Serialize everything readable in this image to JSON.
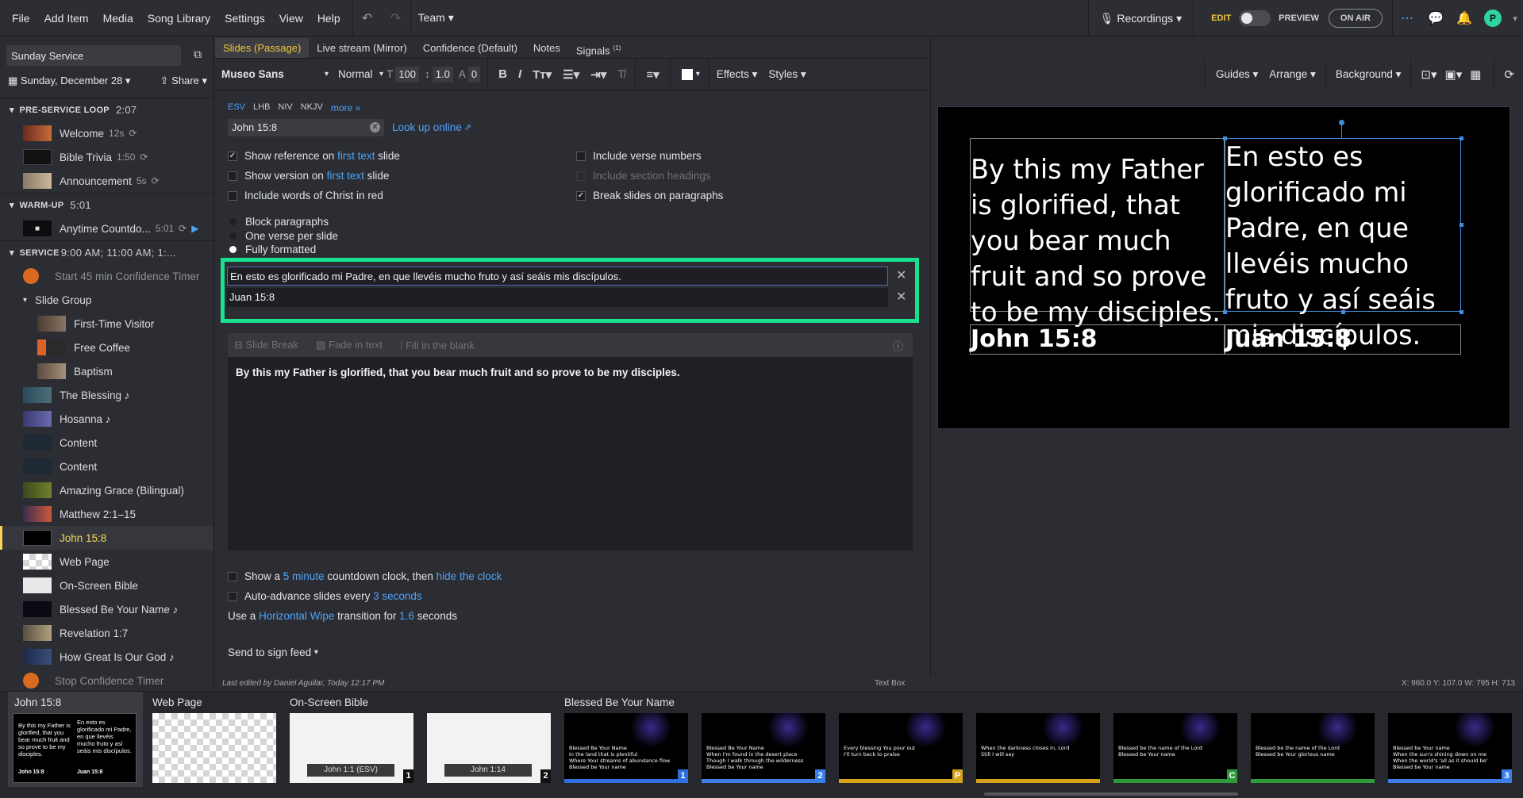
{
  "menu": [
    "File",
    "Add Item",
    "Media",
    "Song Library",
    "Settings",
    "View",
    "Help"
  ],
  "team_label": "Team",
  "topright": {
    "recordings": "Recordings",
    "edit": "EDIT",
    "preview": "PREVIEW",
    "on_air": "ON AIR"
  },
  "sidebar": {
    "service_name": "Sunday Service",
    "date": "Sunday, December 28",
    "share": "Share",
    "sections": [
      {
        "title": "PRE-SERVICE LOOP",
        "duration": "2:07"
      },
      {
        "title": "WARM-UP",
        "duration": "5:01"
      },
      {
        "title": "SERVICE",
        "duration": "9:00 AM; 11:00 AM; 1:..."
      }
    ],
    "preloop_items": [
      {
        "label": "Welcome",
        "meta": "12s"
      },
      {
        "label": "Bible Trivia",
        "meta": "1:50"
      },
      {
        "label": "Announcement",
        "meta": "5s"
      }
    ],
    "warmup_items": [
      {
        "label": "Anytime Countdo...",
        "meta": "5:01"
      }
    ],
    "service_items": [
      {
        "label": "Start 45 min Confidence Timer"
      },
      {
        "label": "Slide Group"
      },
      {
        "label": "First-Time Visitor"
      },
      {
        "label": "Free Coffee"
      },
      {
        "label": "Baptism"
      },
      {
        "label": "The Blessing ♪"
      },
      {
        "label": "Hosanna ♪"
      },
      {
        "label": "Content"
      },
      {
        "label": "Content"
      },
      {
        "label": "Amazing Grace (Bilingual)"
      },
      {
        "label": "Matthew 2:1–15"
      },
      {
        "label": "John 15:8"
      },
      {
        "label": "Web Page"
      },
      {
        "label": "On-Screen Bible"
      },
      {
        "label": "Blessed Be Your Name ♪"
      },
      {
        "label": "Revelation 1:7"
      },
      {
        "label": "How Great Is Our God ♪"
      },
      {
        "label": "Stop Confidence Timer"
      }
    ]
  },
  "tabs": [
    "Slides (Passage)",
    "Live stream (Mirror)",
    "Confidence (Default)",
    "Notes",
    "Signals"
  ],
  "signals_badge": "(1)",
  "format": {
    "font": "Museo Sans",
    "weight": "Normal",
    "size": "100",
    "line": "1.0",
    "spacing": "0",
    "effects": "Effects",
    "styles": "Styles"
  },
  "versions": [
    "ESV",
    "LHB",
    "NIV",
    "NKJV",
    "more »"
  ],
  "reference_value": "John 15:8",
  "lookup_online": "Look up online",
  "options_left": [
    {
      "pre": "Show reference on ",
      "link": "first text",
      "post": " slide",
      "checked": "✓"
    },
    {
      "pre": "Show version on ",
      "link": "first text",
      "post": " slide",
      "checked": ""
    },
    {
      "pre": "Include words of Christ in red",
      "link": "",
      "post": "",
      "checked": ""
    }
  ],
  "options_right": [
    {
      "label": "Include verse numbers",
      "checked": ""
    },
    {
      "label": "Include section headings",
      "checked": ""
    },
    {
      "label": "Break slides on paragraphs",
      "checked": "✓"
    }
  ],
  "radios": [
    "Block paragraphs",
    "One verse per slide",
    "Fully formatted"
  ],
  "translation_text": "En esto es glorificado mi Padre, en que llevéis mucho fruto y así seáis mis discípulos.",
  "translation_ref": "Juan 15:8",
  "editor_tools": [
    "Slide Break",
    "Fade in text",
    "Fill in the blank"
  ],
  "editor_text": "By this my Father is glorified, that you bear much fruit and so prove to be my disciples.",
  "bottom_opts": {
    "countdown": {
      "a": "Show a ",
      "b": "5 minute",
      "c": " countdown clock, then ",
      "d": "hide the clock"
    },
    "advance": {
      "a": "Auto-advance slides every ",
      "b": "3 seconds"
    },
    "transition": {
      "a": "Use a ",
      "b": "Horizontal Wipe",
      "c": " transition for ",
      "d": "1.6",
      "e": " seconds"
    }
  },
  "send_sign": "Send to sign feed",
  "preview_tb": [
    "Guides",
    "Arrange",
    "Background"
  ],
  "slide": {
    "en_text": "By this my Father is glorified, that you bear much fruit and so prove to be my disciples.",
    "es_text": "En esto es glorificado mi Padre, en que llevéis mucho fruto y así seáis mis discípulos.",
    "en_ref": "John 15:8",
    "es_ref": "Juan 15:8"
  },
  "status": {
    "edited": "Last edited by Daniel Aguilar, Today 12:17 PM",
    "textbox": "Text Box",
    "coords": "X: 960.0  Y: 107.0   W: 795  H: 713"
  },
  "filmstrip": {
    "groups": [
      "John 15:8",
      "Web Page",
      "On-Screen Bible",
      "Blessed Be Your Name"
    ],
    "bible_labels": [
      "John 1:1 (ESV)",
      "John 1:14"
    ],
    "song_slides": [
      {
        "text": "Blessed Be Your Name\nIn the land that is plentiful\nWhere Your streams of abundance flow\nBlessed be Your name",
        "num": "1",
        "color": "#2f6fe0"
      },
      {
        "text": "Blessed Be Your Name\nWhen I'm found in the desert place\nThough I walk through the wilderness\nBlessed be Your name",
        "num": "2",
        "color": "#3b7ee8"
      },
      {
        "text": "Every blessing You pour out\nI'll turn back to praise",
        "num": "P",
        "color": "#d4a21c"
      },
      {
        "text": "When the darkness closes in, Lord\nStill I will say",
        "num": "",
        "color": "#d4a21c"
      },
      {
        "text": "Blessed be the name of the Lord\nBlessed be Your name",
        "num": "C",
        "color": "#2f9a3a"
      },
      {
        "text": "Blessed be the name of the Lord\nBlessed be Your glorious name",
        "num": "",
        "color": "#2f9a3a"
      },
      {
        "text": "Blessed be Your name\nWhen the sun's shining down on me\nWhen the world's 'all as it should be'\nBlessed be Your name",
        "num": "3",
        "color": "#3b7ee8"
      }
    ]
  }
}
